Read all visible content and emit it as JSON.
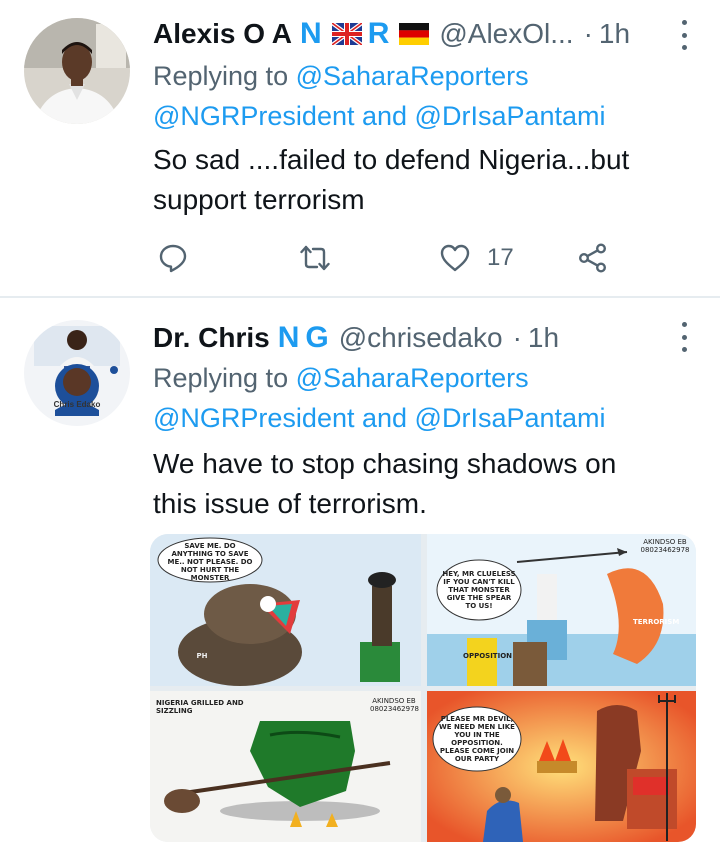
{
  "tweets": [
    {
      "author_name": "Alexis O A",
      "badge_letter_1": "N",
      "badge_letter_2": "R",
      "handle": "@AlexOl...",
      "time": "1h",
      "replying_prefix": "Replying to ",
      "replying_mention_1": "@SaharaReporters",
      "replying_mention_2": "@NGRPresident",
      "replying_and": " and ",
      "replying_mention_3": "@DrIsaPantami",
      "text_line_1": "So sad ....failed to defend Nigeria...but",
      "text_line_2": "support terrorism",
      "like_count": "17"
    },
    {
      "author_name": "Dr. Chris",
      "badge_letter_1": "N",
      "badge_letter_2": "G",
      "handle": "@chrisedako",
      "time": "1h",
      "avatar_caption": "Chris Edako",
      "replying_prefix": "Replying to ",
      "replying_mention_1": "@SaharaReporters",
      "replying_mention_2": "@NGRPresident",
      "replying_and": " and ",
      "replying_mention_3": "@DrIsaPantami",
      "text_line_1": "We have to stop chasing shadows on",
      "text_line_2": "this issue of terrorism.",
      "cartoons": [
        {
          "caption": "SAVE ME. DO ANYTHING TO SAVE ME.. NOT PLEASE. DO NOT HURT THE MONSTER",
          "label": "PH"
        },
        {
          "caption": "HEY, MR CLUELESS IF YOU CAN'T KILL THAT MONSTER GIVE THE SPEAR TO US!",
          "label": "OPPOSITION",
          "label2": "TERRORISM",
          "signature": "AKINDSO EB 08023462978"
        },
        {
          "caption": "NIGERIA GRILLED AND SIZZLING",
          "signature": "AKINDSO EB 08023462978"
        },
        {
          "caption": "PLEASE MR DEVIL, WE NEED MEN LIKE YOU IN THE OPPOSITION. PLEASE COME JOIN OUR PARTY"
        }
      ]
    }
  ],
  "colors": {
    "accent": "#1d9bf0",
    "muted": "#536471",
    "text": "#0f1419",
    "divider": "#e6ecf0"
  },
  "icons": [
    "reply-icon",
    "retweet-icon",
    "like-icon",
    "share-icon",
    "more-icon"
  ]
}
